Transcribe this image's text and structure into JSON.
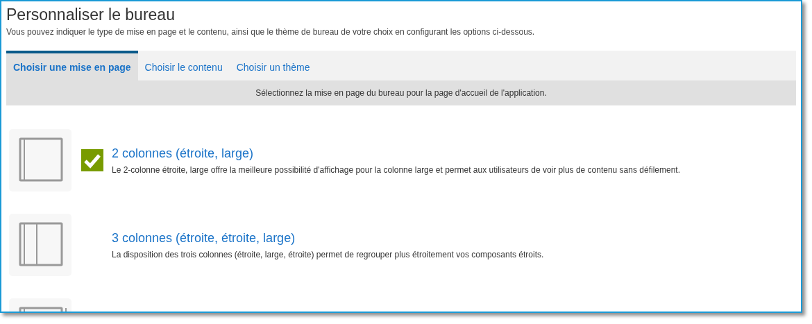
{
  "title": "Personnaliser le bureau",
  "description": "Vous pouvez indiquer le type de mise en page et le contenu, ainsi que le thème de bureau de votre choix en configurant les options ci-dessous.",
  "tabs": [
    {
      "label": "Choisir une mise en page",
      "selected": true
    },
    {
      "label": "Choisir le contenu",
      "selected": false
    },
    {
      "label": "Choisir un thème",
      "selected": false
    }
  ],
  "notice": "Sélectionnez la mise en page du bureau pour la page d'accueil de l'application.",
  "layouts": [
    {
      "kind": "narrow-wide",
      "selected": true,
      "title": "2 colonnes (étroite, large)",
      "description": "Le 2-colonne étroite, large offre la meilleure possibilité d'affichage pour la colonne large et permet aux utilisateurs de voir plus de contenu sans défilement."
    },
    {
      "kind": "narrow-narrow-wide",
      "selected": false,
      "title": "3 colonnes (étroite, étroite, large)",
      "description": "La disposition des trois colonnes (étroite, large, étroite) permet de regrouper plus étroitement vos composants étroits."
    },
    {
      "kind": "narrow-wide-narrow"
    }
  ]
}
